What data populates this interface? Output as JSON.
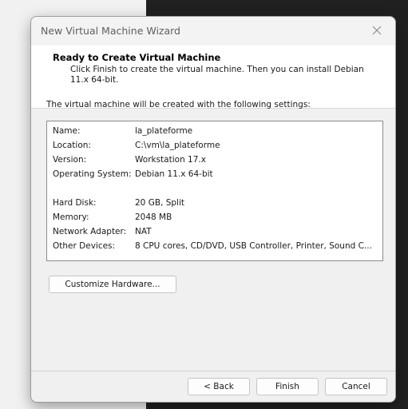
{
  "window": {
    "title": "New Virtual Machine Wizard"
  },
  "header": {
    "title": "Ready to Create Virtual Machine",
    "description": "Click Finish to create the virtual machine. Then you can install Debian 11.x 64-bit."
  },
  "intro_text": "The virtual machine will be created with the following settings:",
  "settings": [
    {
      "label": "Name:",
      "value": "la_plateforme"
    },
    {
      "label": "Location:",
      "value": "C:\\vm\\la_plateforme"
    },
    {
      "label": "Version:",
      "value": "Workstation 17.x"
    },
    {
      "label": "Operating System:",
      "value": "Debian 11.x 64-bit"
    },
    {
      "label": "Hard Disk:",
      "value": "20 GB, Split"
    },
    {
      "label": "Memory:",
      "value": "2048 MB"
    },
    {
      "label": "Network Adapter:",
      "value": "NAT"
    },
    {
      "label": "Other Devices:",
      "value": "8 CPU cores, CD/DVD, USB Controller, Printer, Sound C..."
    }
  ],
  "buttons": {
    "customize": "Customize Hardware...",
    "back": "< Back",
    "finish": "Finish",
    "cancel": "Cancel"
  }
}
